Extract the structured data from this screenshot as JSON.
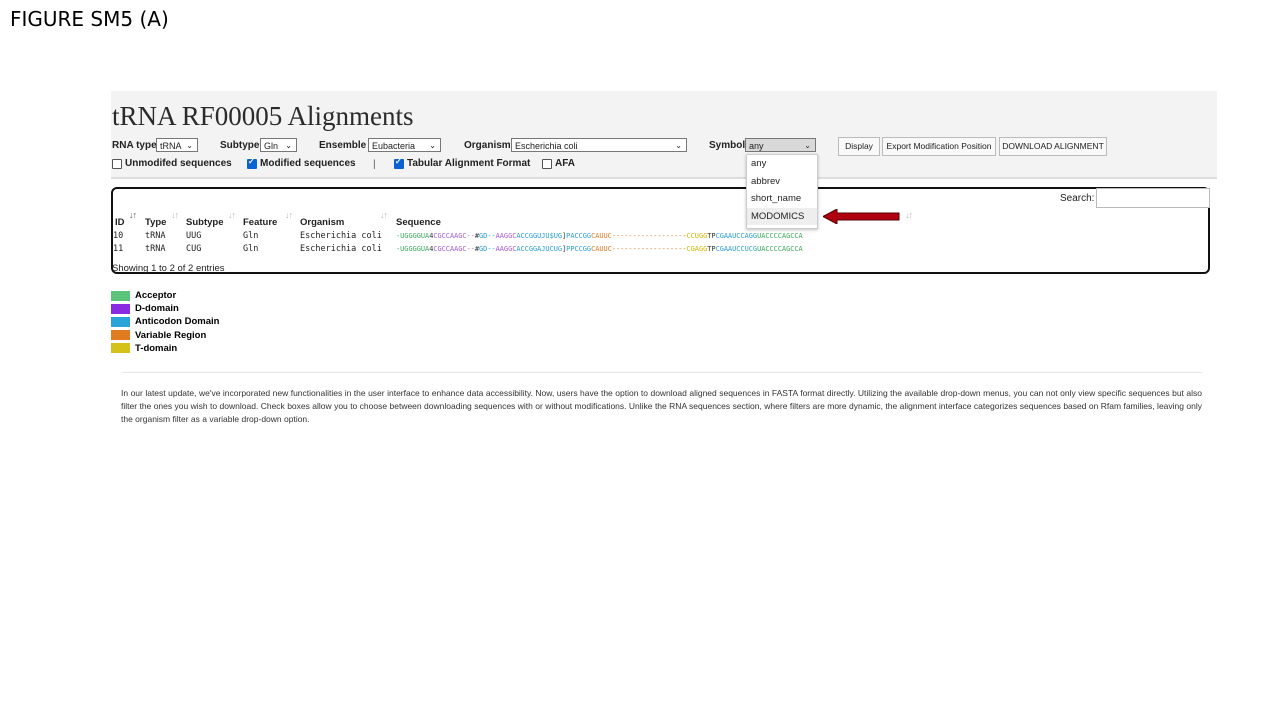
{
  "figure_title": "FIGURE SM5 (A)",
  "page_title": "tRNA RF00005 Alignments",
  "filters": {
    "rna_type": {
      "label": "RNA type",
      "value": "tRNA"
    },
    "subtype": {
      "label": "Subtype",
      "value": "Gln"
    },
    "ensemble": {
      "label": "Ensemble",
      "value": "Eubacteria"
    },
    "organism": {
      "label": "Organism",
      "value": "Escherichia coli"
    },
    "symbol": {
      "label": "Symbol",
      "value": "any",
      "options": [
        "any",
        "abbrev",
        "short_name",
        "MODOMICS"
      ]
    }
  },
  "buttons": {
    "display": "Display",
    "export": "Export Modification Position",
    "download": "DOWNLOAD ALIGNMENT"
  },
  "checkboxes": {
    "unmodified": {
      "label": "Unmodifed sequences",
      "checked": false
    },
    "modified": {
      "label": "Modified sequences",
      "checked": true
    },
    "separator": "|",
    "tabular": {
      "label": "Tabular Alignment Format",
      "checked": true
    },
    "afa": {
      "label": "AFA",
      "checked": false
    }
  },
  "search": {
    "label": "Search:",
    "value": ""
  },
  "table": {
    "columns": [
      "ID",
      "Type",
      "Subtype",
      "Feature",
      "Organism",
      "Sequence"
    ],
    "rows": [
      {
        "id": "10",
        "type": "tRNA",
        "subtype": "UUG",
        "feature": "Gln",
        "organism": "Escherichia coli",
        "seq": [
          {
            "t": "-UGGGGUA",
            "c": "acceptor"
          },
          {
            "t": "4",
            "c": "plain"
          },
          {
            "t": "CGCCAAGC--",
            "c": "ddomain"
          },
          {
            "t": "#",
            "c": "plain"
          },
          {
            "t": "GD--",
            "c": "anticodon"
          },
          {
            "t": "AAGGC",
            "c": "ddomain"
          },
          {
            "t": "ACCGGUJU$UG",
            "c": "anticodon"
          },
          {
            "t": "]",
            "c": "plain"
          },
          {
            "t": "PACCGG",
            "c": "anticodon"
          },
          {
            "t": "CAUUC------------------",
            "c": "variable"
          },
          {
            "t": "CCUGG",
            "c": "tdomain"
          },
          {
            "t": "TP",
            "c": "plain"
          },
          {
            "t": "CGAAUCCAGG",
            "c": "anticodon"
          },
          {
            "t": "UACCCCAGCCA",
            "c": "acceptor"
          }
        ]
      },
      {
        "id": "11",
        "type": "tRNA",
        "subtype": "CUG",
        "feature": "Gln",
        "organism": "Escherichia coli",
        "seq": [
          {
            "t": "-UGGGGUA",
            "c": "acceptor"
          },
          {
            "t": "4",
            "c": "plain"
          },
          {
            "t": "CGCCAAGC--",
            "c": "ddomain"
          },
          {
            "t": "#",
            "c": "plain"
          },
          {
            "t": "GD--",
            "c": "anticodon"
          },
          {
            "t": "AAGGC",
            "c": "ddomain"
          },
          {
            "t": "ACCGGAJUCUG",
            "c": "anticodon"
          },
          {
            "t": "]",
            "c": "plain"
          },
          {
            "t": "PPCCGG",
            "c": "anticodon"
          },
          {
            "t": "CAUUC------------------",
            "c": "variable"
          },
          {
            "t": "CGAGG",
            "c": "tdomain"
          },
          {
            "t": "TP",
            "c": "plain"
          },
          {
            "t": "CGAAUCCUCG",
            "c": "anticodon"
          },
          {
            "t": "UACCCCAGCCA",
            "c": "acceptor"
          }
        ]
      }
    ]
  },
  "info": "Showing 1 to 2 of 2 entries",
  "legend": [
    {
      "label": "Acceptor",
      "color": "#5cc47a"
    },
    {
      "label": "D-domain",
      "color": "#8a2be2"
    },
    {
      "label": "Anticodon Domain",
      "color": "#2aa3d8"
    },
    {
      "label": "Variable Region",
      "color": "#e07b20"
    },
    {
      "label": "T-domain",
      "color": "#d4c21a"
    }
  ],
  "colors": {
    "acceptor": "#3dab5a",
    "ddomain": "#a45bd6",
    "anticodon": "#2a9fd4",
    "variable": "#e07b20",
    "tdomain": "#d4b800",
    "plain": "#333333",
    "arrow": "#b00010"
  },
  "description": "In our latest update, we've incorporated new functionalities in the user interface to enhance data accessibility. Now, users have the option to download aligned sequences in FASTA format directly. Utilizing the available drop-down menus, you can not only view specific sequences but also filter the ones you wish to download. Check boxes allow you to choose between downloading sequences with or without modifications. Unlike the RNA sequences section, where filters are more dynamic, the alignment interface categorizes sequences based on Rfam families, leaving only the organism filter as a variable drop-down option."
}
